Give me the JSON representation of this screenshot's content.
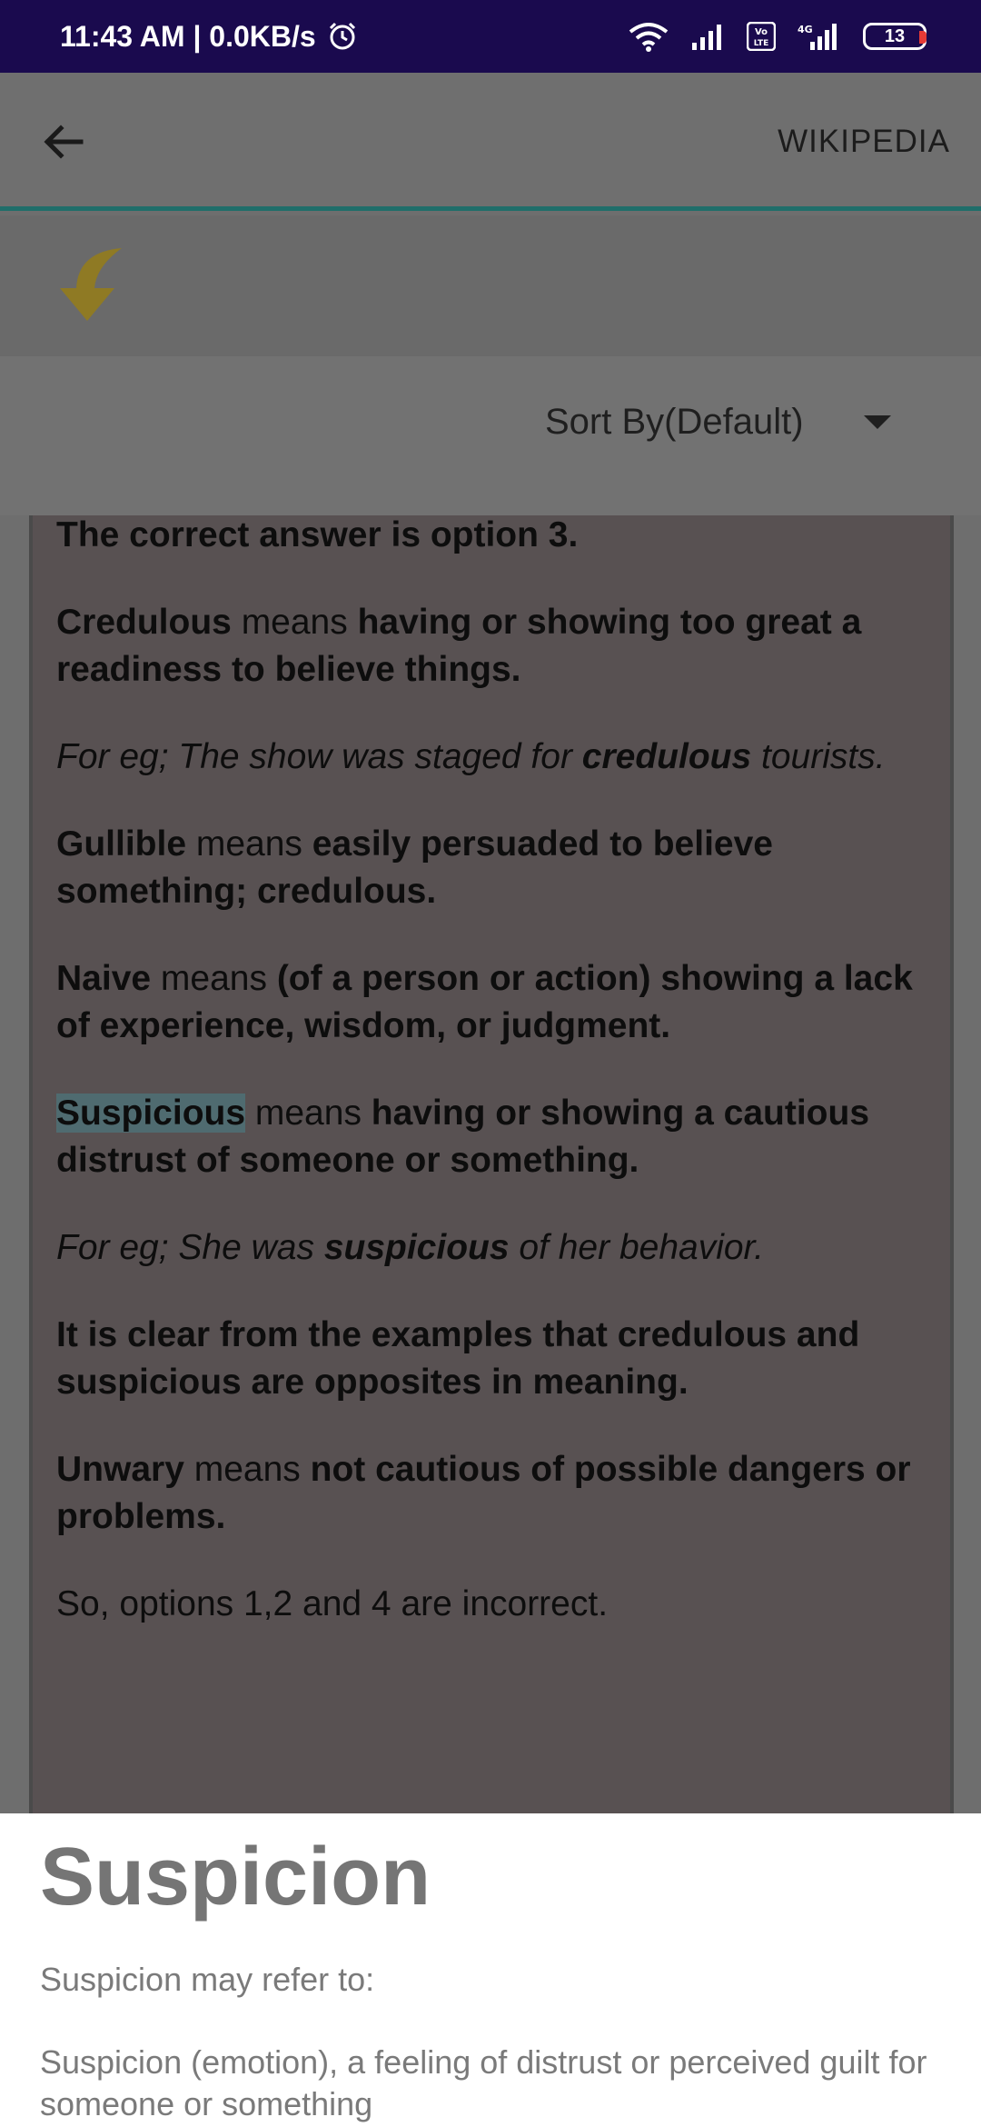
{
  "status_bar": {
    "time_speed": "11:43 AM | 0.0KB/s",
    "battery": "13",
    "network": "4G",
    "volte": "Vo LTE"
  },
  "app_bar": {
    "back_icon": "arrow-left-icon",
    "source_label": "WIKIPEDIA",
    "accent_color": "#1f6e6a"
  },
  "toolbar": {
    "icon": "curved-arrow-down-icon",
    "icon_color": "#c9a227"
  },
  "sort": {
    "label": "Sort By(Default)"
  },
  "explanation": {
    "answer": "The correct answer is option 3.",
    "credulous_word": "Credulous",
    "means": " means ",
    "credulous_def": "having or showing too great a readiness to believe things.",
    "eg1_prefix": "For eg; The show was staged for ",
    "eg1_word": "credulous",
    "eg1_suffix": " tourists.",
    "gullible_word": "Gullible",
    "gullible_def": "easily persuaded to believe something; credulous.",
    "naive_word": "Naive",
    "naive_def": "(of a person or action) showing a lack of experience, wisdom, or judgment.",
    "suspicious_word": "Suspicious",
    "suspicious_def": "having or showing a cautious distrust of someone or something.",
    "eg2_prefix": "For eg; She was ",
    "eg2_word": "suspicious",
    "eg2_suffix": " of her behavior.",
    "conclusion": "It is clear from the examples that credulous and suspicious are opposites in meaning.",
    "unwary_word": "Unwary",
    "unwary_def": "not cautious of possible dangers or problems.",
    "incorrect": "So, options 1,2 and 4 are incorrect."
  },
  "wiki_sheet": {
    "title": "Suspicion",
    "intro": "Suspicion may refer to:",
    "item1": "Suspicion (emotion), a feeling of distrust or perceived guilt for someone or something"
  }
}
